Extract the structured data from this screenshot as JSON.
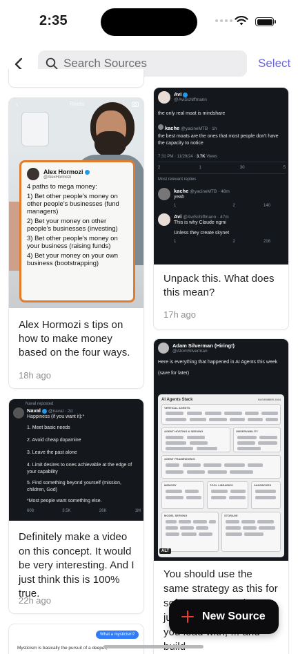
{
  "status_bar": {
    "time": "2:35"
  },
  "nav": {
    "search_placeholder": "Search Sources",
    "select_label": "Select"
  },
  "cards": {
    "hormozi": {
      "overlay_label": "Reels",
      "tweet_name": "Alex Hormozi",
      "tweet_handle": "@AlexHormozi",
      "lines": [
        "4 paths to mega money:",
        "1) Bet other people's money on other people's businesses (fund managers)",
        "2) Bet your money on other people's businesses (investing)",
        "3) Bet other people's money on your business (raising funds)",
        "4) Bet your money on your own business (bootstrapping)"
      ],
      "caption": "Alex Hormozi s tips on how to make money based on the four ways.",
      "age": "18h ago"
    },
    "naval": {
      "reposted": "Naval reposted",
      "name": "Naval",
      "handle": "@naval · 2d",
      "lines": [
        "Happiness (if you want it):*",
        "1. Meet basic needs",
        "2. Avoid cheap dopamine",
        "3. Leave the past alone",
        "4. Limit desires to ones achievable at the edge of your capability",
        "5. Find something beyond yourself (mission, children, God)",
        "*Most people want something else."
      ],
      "stats": [
        "608",
        "3.5K",
        "26K",
        "1M"
      ],
      "caption": "Definitely make a video on this concept. It would be very interesting. And I just think this is 100% true.",
      "age": "22h ago"
    },
    "mysticism": {
      "bubble": "What a mysticism?",
      "text": "Mysticism is basically the pursuit of a deeper,"
    },
    "avi": {
      "name": "Avi",
      "handle": "@AviSchiffmann",
      "text": "the only real moat is mindshare",
      "quote_name": "kache",
      "quote_handle": "@yacineMTB · 1h",
      "quote_text": "the best moats are the ones that most people don't have the capacity to notice",
      "meta_time": "7:31 PM · 11/29/24 · ",
      "meta_views": "3.7K",
      "meta_views_label": "Views",
      "stats": [
        "2",
        "1",
        "30",
        "5"
      ],
      "replies_label": "Most relevant replies",
      "reply1_name": "kache",
      "reply1_handle": "@yacineMTB · 48m",
      "reply1_text": "yeah",
      "reply1_stats": [
        "1",
        "",
        "2",
        "140"
      ],
      "reply2_name": "Avi",
      "reply2_handle": "@AviSchiffmann · 47m",
      "reply2_text": "This is why Claude ngmi",
      "reply3_text": "Unless they create skynet",
      "reply3_stats": [
        "1",
        "",
        "2",
        "216"
      ],
      "caption": "Unpack this. What does this mean?",
      "age": "17h ago"
    },
    "adam": {
      "name": "Adam Silverman (Hiring!)",
      "handle": "@AtomSilverman",
      "text": "Here is everything that happened in AI Agents this week",
      "text2": "(save for later)",
      "infographic_title": "AI Agents Stack",
      "infographic_date": "NOVEMBER 2024",
      "sections": [
        "VERTICAL AGENTS",
        "AGENT HOSTING & SERVING",
        "OBSERVABILITY",
        "AGENT FRAMEWORKS",
        "MEMORY",
        "TOOL LIBRARIES",
        "SANDBOXES",
        "MODEL SERVING",
        "STORAGE"
      ],
      "alt_badge": "ALT",
      "caption": "You should use the same strategy as this for software companies or just... b... mind map that you lead with, ... and build"
    }
  },
  "fab": {
    "label": "New Source"
  }
}
